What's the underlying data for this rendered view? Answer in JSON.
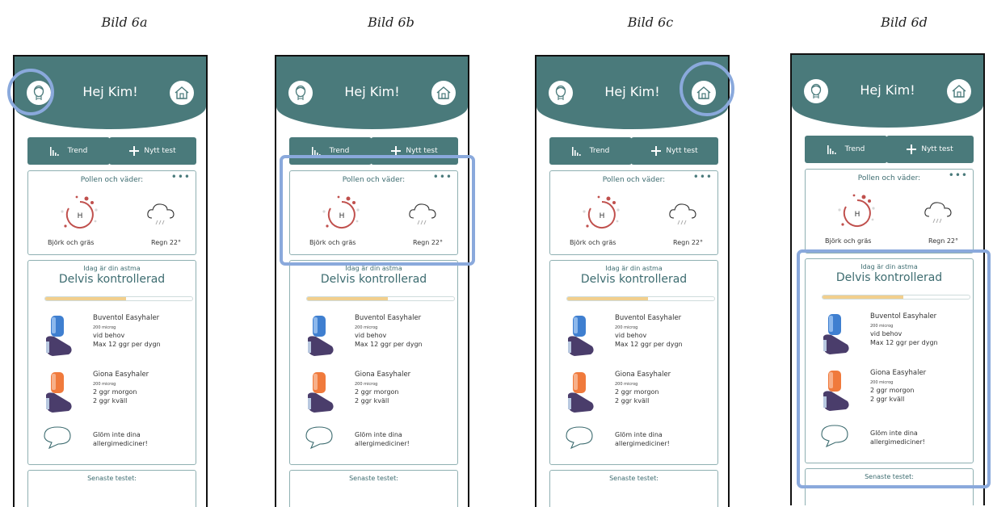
{
  "captions": [
    "Bild 6a",
    "Bild 6b",
    "Bild 6c",
    "Bild 6d"
  ],
  "app": {
    "greeting": "Hej Kim!",
    "buttons": {
      "trend": "Trend",
      "new_test": "Nytt test"
    },
    "pollen_card": {
      "title": "Pollen och väder:",
      "menu": "•••",
      "pollen_level": "H",
      "pollen_label": "Björk och gräs",
      "weather_label": "Regn 22°"
    },
    "asthma_card": {
      "subtitle": "Idag är din astma",
      "status": "Delvis kontrollerad",
      "progress_fraction": 0.55,
      "medications": [
        {
          "name": "Buventol Easyhaler",
          "dose": "200 microg",
          "line1": "vid behov",
          "line2": "Max 12 ggr per dygn",
          "color": "#3f7fd0"
        },
        {
          "name": "Giona Easyhaler",
          "dose": "200 microg",
          "line1": "2 ggr morgon",
          "line2": "2 ggr kväll",
          "color": "#f07a3c"
        }
      ],
      "reminder_line1": "Glöm inte dina",
      "reminder_line2": "allergimediciner!"
    },
    "last_test_card": {
      "title": "Senaste testet:"
    }
  },
  "colors": {
    "header": "#4a7a7b",
    "highlight": "#8aa9dc",
    "progress": "#f2cf8d",
    "pollen_ring": "#c0504d"
  }
}
